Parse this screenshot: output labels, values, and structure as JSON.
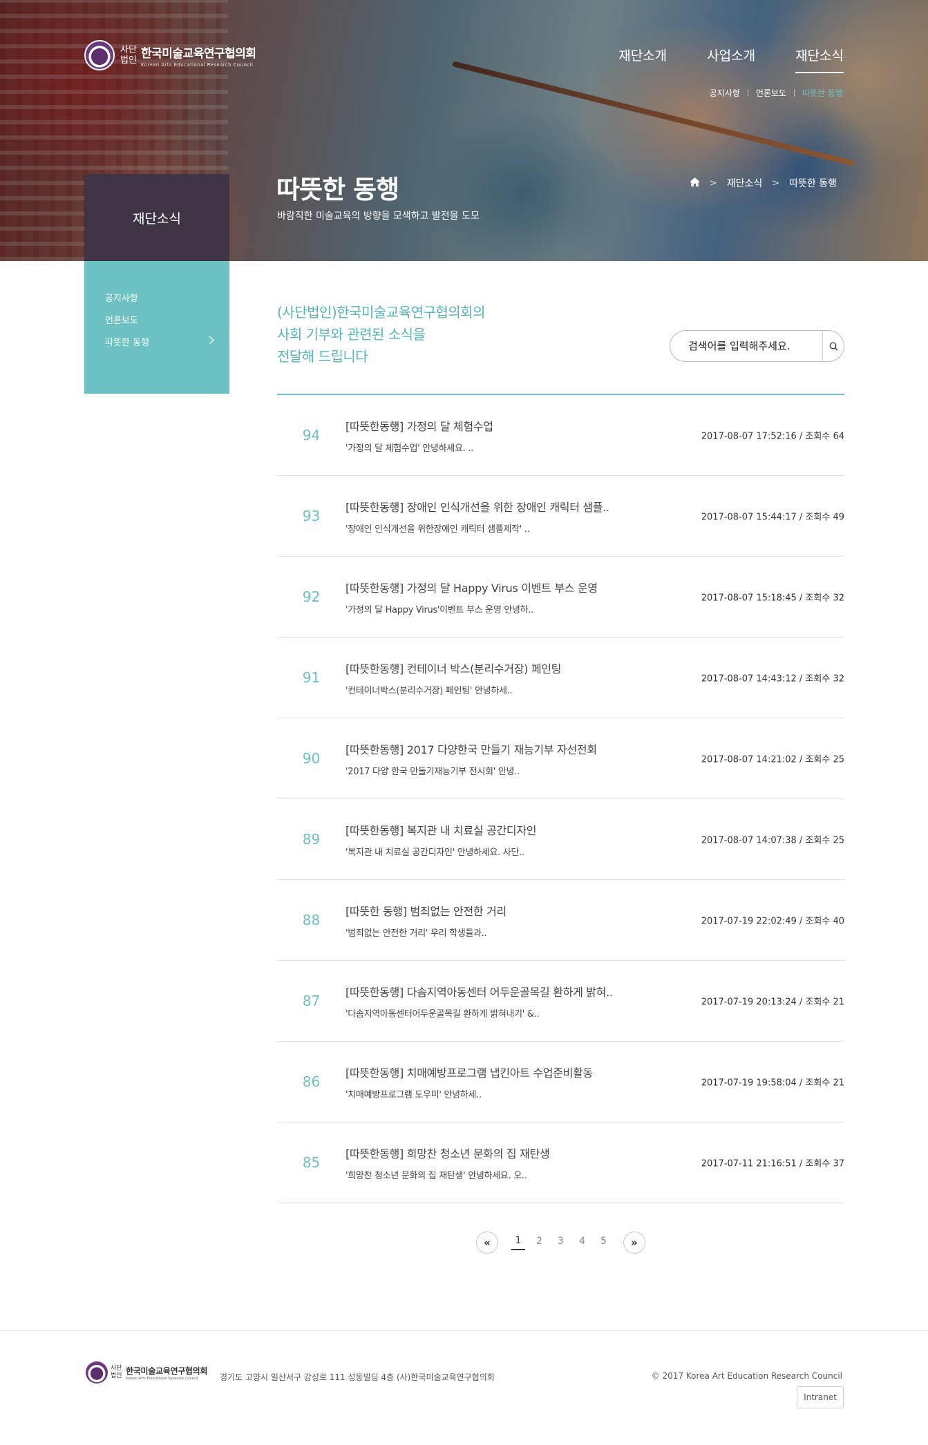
{
  "brand": {
    "corp_type": "사단 법인",
    "name": "한국미술교육연구협의회",
    "english": "Korean Arts Educational Research Council"
  },
  "gnb": {
    "items": [
      {
        "label": "재단소개"
      },
      {
        "label": "사업소개"
      },
      {
        "label": "재단소식"
      }
    ],
    "active_index": 2
  },
  "sub_gnb": {
    "items": [
      {
        "label": "공지사항"
      },
      {
        "label": "언론보도"
      },
      {
        "label": "따뜻한 동행"
      }
    ]
  },
  "hero": {
    "title": "따뜻한 동행",
    "description": "바람직한 미술교육의 방향을 모색하고 발전을 도모"
  },
  "breadcrumb": {
    "home_icon": "home-icon",
    "items": [
      "재단소식",
      "따뜻한 동행"
    ]
  },
  "sidebar": {
    "heading": "재단소식",
    "items": [
      {
        "label": "공지사항"
      },
      {
        "label": "언론보도"
      },
      {
        "label": "따뜻한 동행"
      }
    ]
  },
  "intro": {
    "line1": "(사단법인)한국미술교육연구협의회의",
    "line2": "사회 기부와 관련된 소식을",
    "line3": "전달해 드립니다"
  },
  "search": {
    "placeholder": "검색어를 입력해주세요.",
    "icon": "search-icon"
  },
  "posts": [
    {
      "num": "94",
      "title": "[따뜻한동행] 가정의 달 체험수업",
      "summary": "'가정의 달 체험수업'   안녕하세요. ..",
      "meta": "2017-08-07 17:52:16 / 조회수 64"
    },
    {
      "num": "93",
      "title": "[따뜻한동행] 장애인 인식개선을 위한 장애인 캐릭터 샘플..",
      "summary": "'장애인 인식개선을 위한장애인 캐릭터 샘플제작'   ..",
      "meta": "2017-08-07 15:44:17 / 조회수 49"
    },
    {
      "num": "92",
      "title": "[따뜻한동행] 가정의 달 Happy Virus 이벤트 부스 운영",
      "summary": "'가정의 달 Happy Virus'이벤트 부스 운영   안녕하..",
      "meta": "2017-08-07 15:18:45 / 조회수 32"
    },
    {
      "num": "91",
      "title": "[따뜻한동행] 컨테이너 박스(분리수거장) 페인팅",
      "summary": "'컨테이너박스(분리수거장) 페인팅'  안녕하세..",
      "meta": "2017-08-07 14:43:12 / 조회수 32"
    },
    {
      "num": "90",
      "title": "[따뜻한동행] 2017 다양한국 만들기 재능기부 자선전회",
      "summary": "'2017 다양 한국 만들기재능기부 전시회'  안녕..",
      "meta": "2017-08-07 14:21:02 / 조회수 25"
    },
    {
      "num": "89",
      "title": "[따뜻한동행] 복지관 내 치료실 공간디자인",
      "summary": "'복지관 내 치료실 공간디자인'  안녕하세요. 사단..",
      "meta": "2017-08-07 14:07:38 / 조회수 25"
    },
    {
      "num": "88",
      "title": "[따뜻한 동행] 범죄없는 안전한 거리",
      "summary": "'범죄없는 안전한 거리'    우리 학생들과..",
      "meta": "2017-07-19 22:02:49 / 조회수 40"
    },
    {
      "num": "87",
      "title": "[따뜻한동행] 다솜지역아동센터 어두운골목길 환하게 밝혀..",
      "summary": "'다솜지역아동센터어두운골목길 환하게 밝혀내기'  &..",
      "meta": "2017-07-19 20:13:24 / 조회수 21"
    },
    {
      "num": "86",
      "title": "[따뜻한동행] 치매예방프로그램 냅킨아트 수업준비활동",
      "summary": "'치매예방프로그램 도우미'    안녕하세..",
      "meta": "2017-07-19 19:58:04 / 조회수 21"
    },
    {
      "num": "85",
      "title": "[따뜻한동행] 희망찬 청소년 문화의 집 재탄생",
      "summary": "'희망찬 청소년 문화의 집 재탄생'  안녕하세요. 오..",
      "meta": "2017-07-11 21:16:51 / 조회수 37"
    }
  ],
  "pagination": {
    "prev": "«",
    "next": "»",
    "pages": [
      "1",
      "2",
      "3",
      "4",
      "5"
    ],
    "current": "1"
  },
  "footer": {
    "corp_type": "사단 법인",
    "name": "한국미술교육연구협의회",
    "english": "Korean Arts Educational Research Council",
    "address": "경기도 고양시 일산서구 강성로 111 성동빌딩 4층 (사)한국미술교육연구협의회",
    "copyright": "© 2017 Korea Art Education Research Council",
    "intranet": "Intranet"
  },
  "colors": {
    "accent": "#6ec1c2",
    "sidebar_head": "#3f3443"
  }
}
